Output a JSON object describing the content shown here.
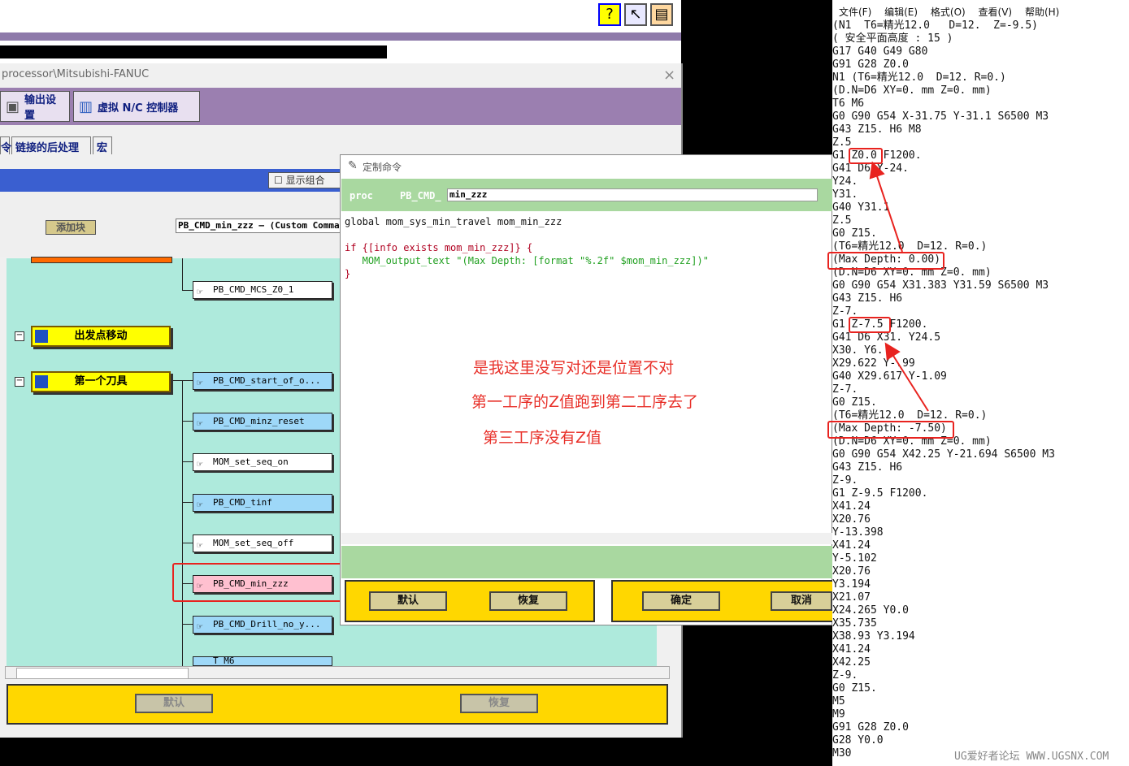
{
  "top": {
    "help_icons": [
      "help-question-icon",
      "whats-this-icon",
      "book-icon"
    ]
  },
  "window2": {
    "title": "processor\\Mitsubishi-FANUC",
    "close": "×",
    "toolbar": {
      "output_settings": "输出设置",
      "virtual_nc": "虚拟 N/C 控制器"
    },
    "tabs": {
      "t0": "令",
      "t1": "链接的后处理",
      "t2": "宏"
    },
    "show_combo": "显示组合",
    "add_block": "添加块",
    "custom_box": "PB_CMD_min_zzz — (Custom Command)",
    "tree": {
      "top_node": "PB_CMD_MCS_Z0_1",
      "start_move": "出发点移动",
      "first_tool": "第一个刀具",
      "items": [
        "PB_CMD_start_of_o...",
        "PB_CMD_minz_reset",
        "MOM_set_seq_on",
        "PB_CMD_tinf",
        "MOM_set_seq_off",
        "PB_CMD_min_zzz",
        "PB_CMD_Drill_no_y...",
        "T_M6"
      ]
    },
    "bottom": {
      "default": "默认",
      "restore": "恢复"
    }
  },
  "dialog": {
    "title": "定制命令",
    "proc_label": "proc",
    "proc_prefix": "PB_CMD_",
    "proc_name": "min_zzz",
    "code": [
      "global mom_sys_min_travel mom_min_zzz",
      "",
      "if {[info exists mom_min_zzz]} {",
      "   MOM_output_text \"(Max Depth: [format \"%.2f\" $mom_min_zzz])\"",
      "}"
    ],
    "notes": [
      "是我这里没写对还是位置不对",
      "第一工序的Z值跑到第二工序去了",
      "第三工序没有Z值"
    ],
    "buttons": {
      "default": "默认",
      "restore": "恢复",
      "ok": "确定",
      "cancel": "取消"
    }
  },
  "notepad": {
    "menu": [
      "文件(F)",
      "编辑(E)",
      "格式(O)",
      "查看(V)",
      "帮助(H)"
    ],
    "lines": [
      "(N1  T6=精光12.0   D=12.  Z=-9.5)",
      "( 安全平面高度 : 15 )",
      "G17 G40 G49 G80",
      "G91 G28 Z0.0",
      "N1 (T6=精光12.0  D=12. R=0.)",
      "(D.N=D6 XY=0. mm Z=0. mm)",
      "T6 M6",
      "G0 G90 G54 X-31.75 Y-31.1 S6500 M3",
      "G43 Z15. H6 M8",
      "Z.5",
      "G1 Z0.0 F1200.",
      "G41 D6 Y-24.",
      "Y24.",
      "Y31.",
      "G40 Y31.1",
      "Z.5",
      "G0 Z15.",
      "(T6=精光12.0  D=12. R=0.)",
      "(Max Depth: 0.00)",
      "(D.N=D6 XY=0. mm Z=0. mm)",
      "G0 G90 G54 X31.383 Y31.59 S6500 M3",
      "G43 Z15. H6",
      "Z-7.",
      "G1 Z-7.5 F1200.",
      "G41 D6 X31. Y24.5",
      "X30. Y6.",
      "X29.622 Y-.99",
      "G40 X29.617 Y-1.09",
      "Z-7.",
      "G0 Z15.",
      "(T6=精光12.0  D=12. R=0.)",
      "(Max Depth: -7.50)",
      "(D.N=D6 XY=0. mm Z=0. mm)",
      "G0 G90 G54 X42.25 Y-21.694 S6500 M3",
      "G43 Z15. H6",
      "Z-9.",
      "G1 Z-9.5 F1200.",
      "X41.24",
      "X20.76",
      "Y-13.398",
      "X41.24",
      "Y-5.102",
      "X20.76",
      "Y3.194",
      "X21.07",
      "X24.265 Y0.0",
      "X35.735",
      "X38.93 Y3.194",
      "X41.24",
      "X42.25",
      "Z-9.",
      "G0 Z15.",
      "M5",
      "M9",
      "G91 G28 Z0.0",
      "G28 Y0.0",
      "M30"
    ],
    "watermark": "UG爱好者论坛 WWW.UGSNX.COM"
  }
}
